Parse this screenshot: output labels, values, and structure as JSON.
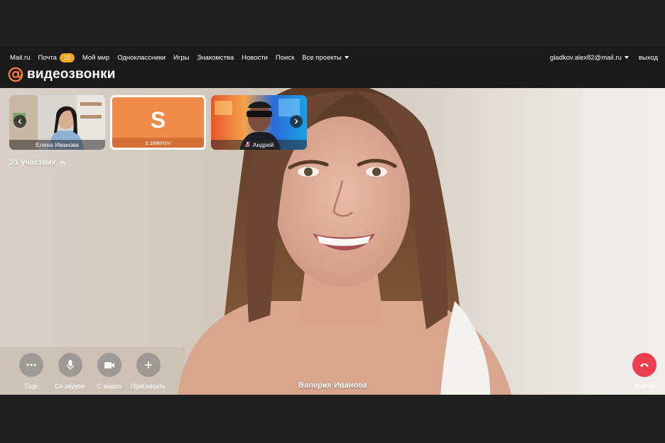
{
  "portal": {
    "nav": [
      {
        "label": "Mail.ru"
      },
      {
        "label": "Почта",
        "badge": "12"
      },
      {
        "label": "Мой мир"
      },
      {
        "label": "Одноклассники"
      },
      {
        "label": "Игры"
      },
      {
        "label": "Знакомства"
      },
      {
        "label": "Новости"
      },
      {
        "label": "Поиск"
      },
      {
        "label": "Все проекты"
      }
    ],
    "user_email": "gladkov.alex82@mail.ru",
    "logout": "выход"
  },
  "app": {
    "title": "видеозвонки",
    "brand_color": "#f5793a"
  },
  "participants": {
    "tiles": [
      {
        "name": "Елена Иванова",
        "type": "video"
      },
      {
        "name": "s.zelenov",
        "type": "avatar",
        "letter": "S",
        "color": "#f08a4b"
      },
      {
        "name": "Андрей",
        "type": "video",
        "muted": true
      }
    ],
    "count_label": "21 участник"
  },
  "main_speaker": {
    "name": "Валерия Иванова"
  },
  "controls": [
    {
      "label": "Еще",
      "icon": "more-icon"
    },
    {
      "label": "Со звуком",
      "icon": "microphone-icon"
    },
    {
      "label": "С видео",
      "icon": "camera-icon"
    },
    {
      "label": "Пригласить",
      "icon": "plus-icon"
    }
  ],
  "exit": {
    "label": "Выйти",
    "icon": "hangup-icon",
    "color": "#ee3e52"
  }
}
